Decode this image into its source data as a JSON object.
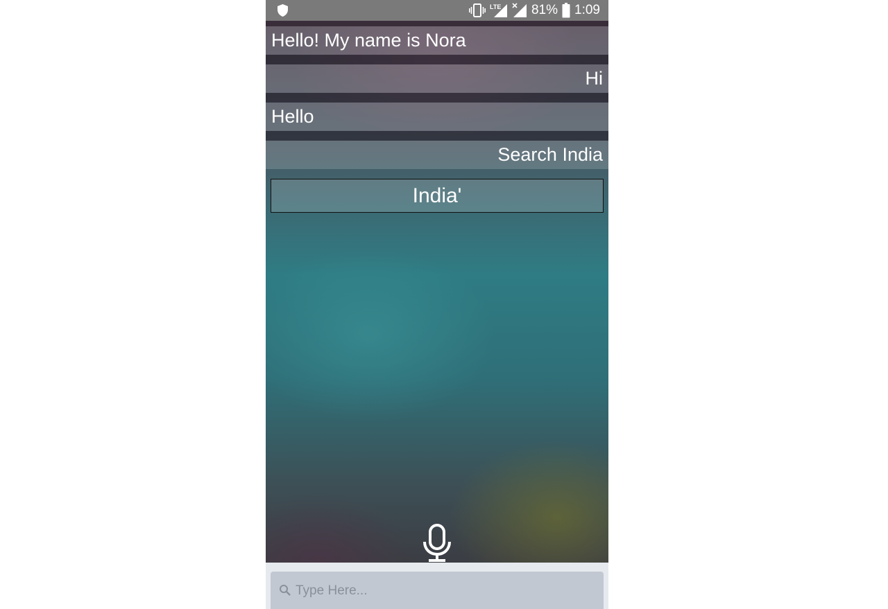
{
  "status_bar": {
    "battery": "81%",
    "time": "1:09",
    "network": "LTE",
    "icons": [
      "shield-icon",
      "vibrate-icon",
      "lte-signal-icon",
      "no-signal-icon",
      "battery-icon"
    ]
  },
  "conversation": {
    "messages": [
      {
        "text": "Hello! My name is Nora",
        "align": "left"
      },
      {
        "text": "Hi",
        "align": "right"
      },
      {
        "text": "Hello",
        "align": "left"
      },
      {
        "text": "Search India",
        "align": "right"
      }
    ],
    "result": "India'"
  },
  "input": {
    "placeholder": "Type Here...",
    "value": ""
  },
  "icons": {
    "mic": "microphone-icon",
    "search": "search-icon"
  }
}
